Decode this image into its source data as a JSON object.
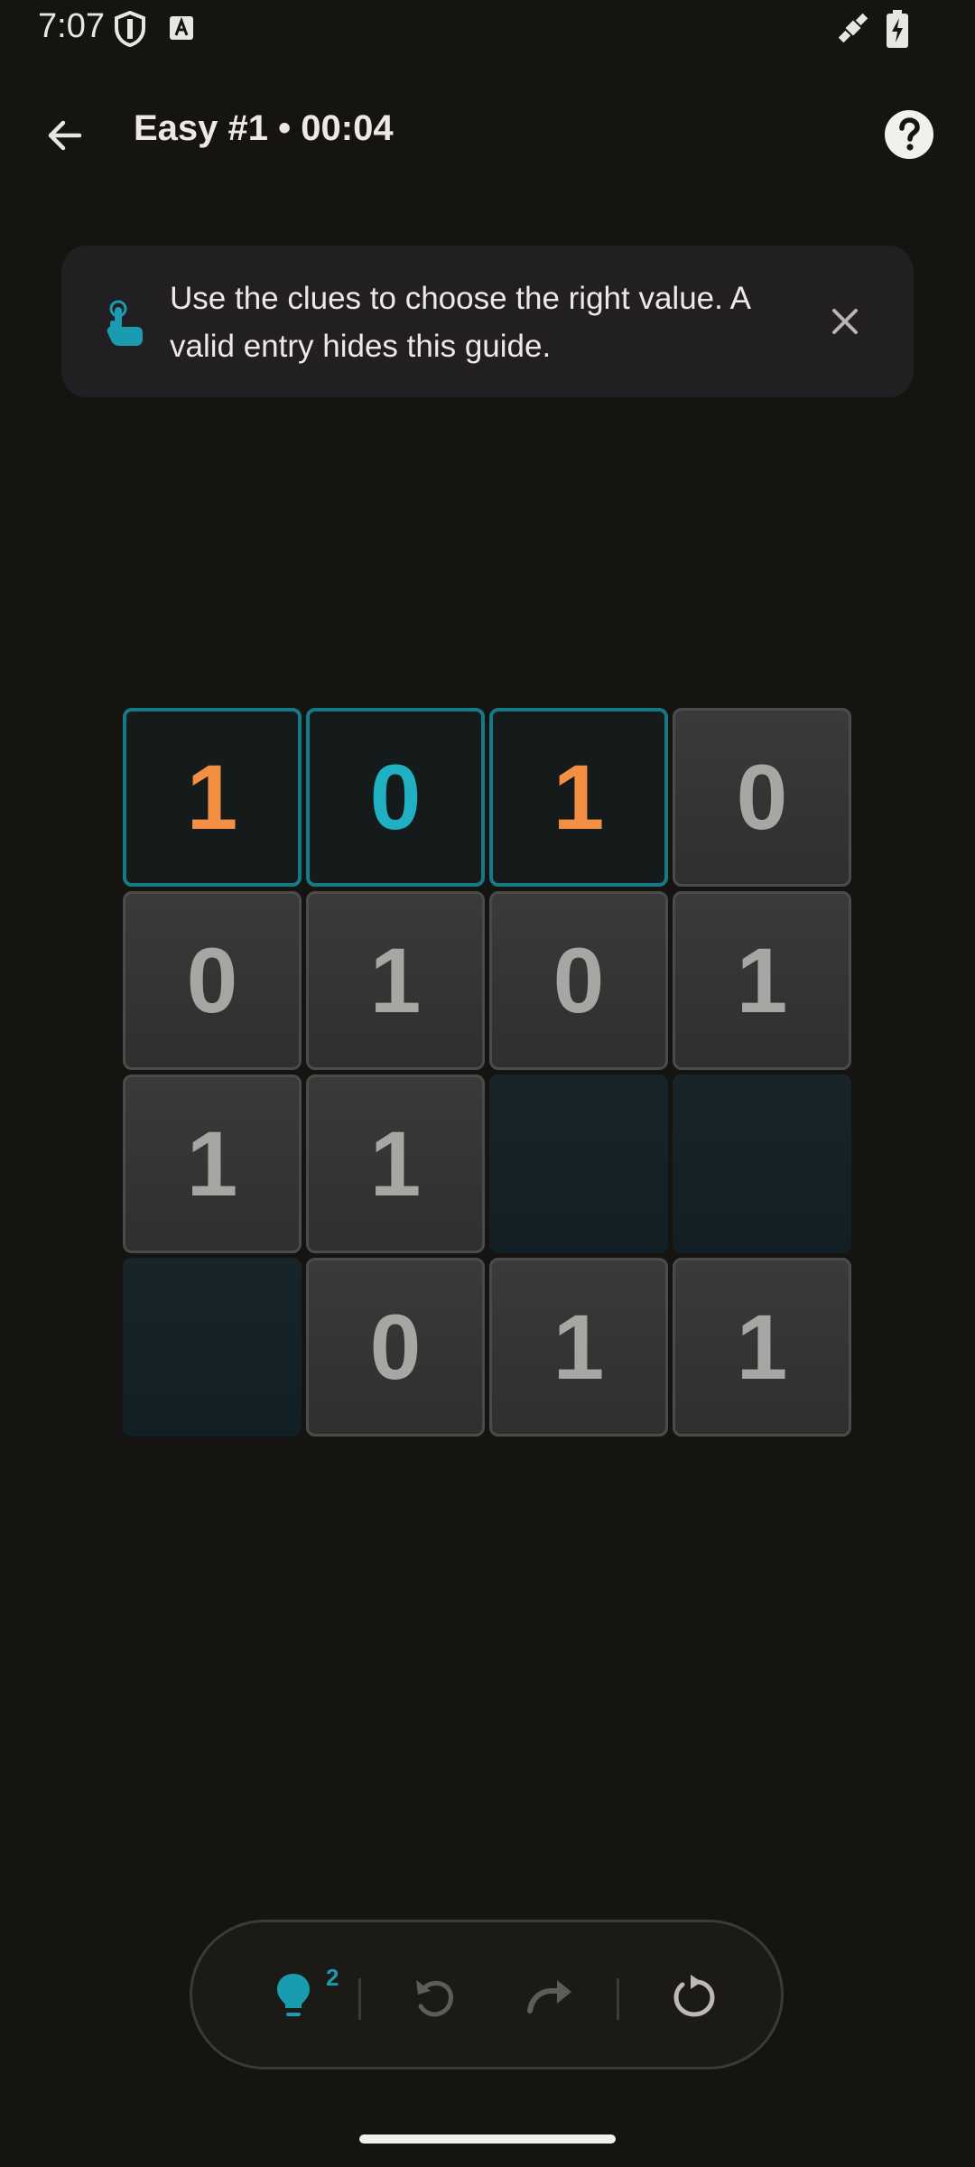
{
  "status": {
    "time": "7:07"
  },
  "header": {
    "title": "Easy #1 • 00:04"
  },
  "guide": {
    "text": "Use the clues to choose the right value. A valid entry hides this guide."
  },
  "board": {
    "rows": 4,
    "cols": 4,
    "cells": [
      [
        "1",
        "0",
        "1",
        "0"
      ],
      [
        "0",
        "1",
        "0",
        "1"
      ],
      [
        "1",
        "1",
        "",
        ""
      ],
      [
        "",
        "0",
        "1",
        "1"
      ]
    ],
    "selected_row": 0,
    "colors": {
      "accent": "#157a86",
      "orange": "#f28f43",
      "cyan": "#1fb0c4"
    }
  },
  "toolbar": {
    "hint_count": "2"
  }
}
